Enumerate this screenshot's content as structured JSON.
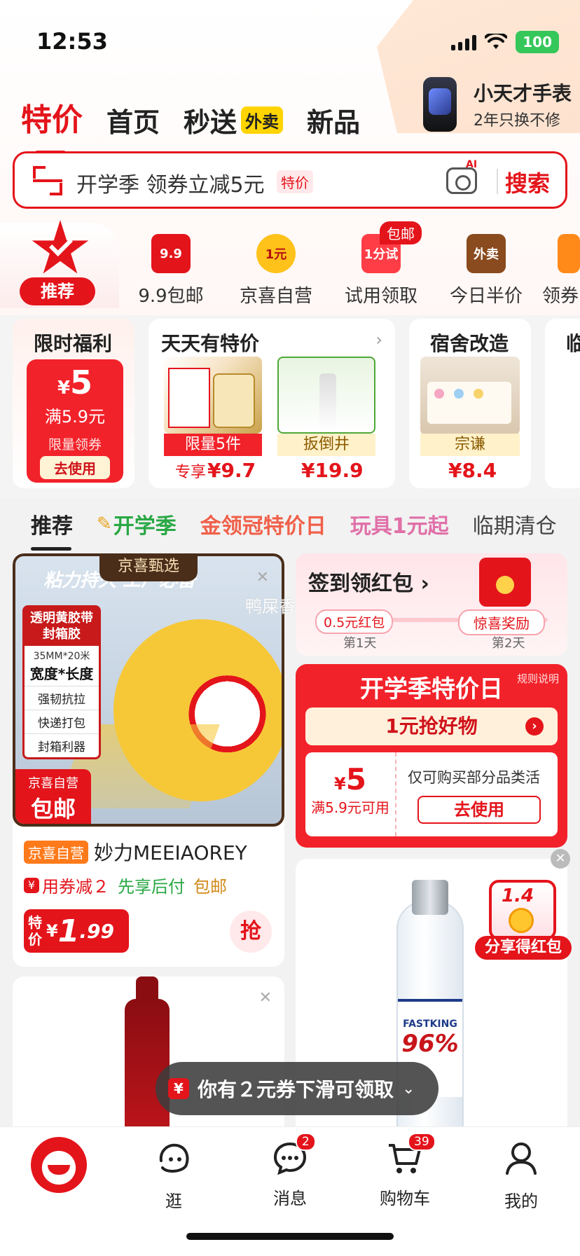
{
  "status": {
    "time": "12:53",
    "battery": "100"
  },
  "header_promo": {
    "title": "小天才手表",
    "subtitle": "2年只换不修"
  },
  "top_tabs": [
    {
      "label": "特价",
      "active": true
    },
    {
      "label": "首页"
    },
    {
      "label": "秒送",
      "badge": "外卖"
    },
    {
      "label": "新品"
    }
  ],
  "search": {
    "placeholder": "开学季 领券立减5元",
    "tag": "特价",
    "ai_label": "AI",
    "button": "搜索"
  },
  "categories": [
    {
      "label": "推荐",
      "icon": "star-check-icon"
    },
    {
      "label": "9.9包邮",
      "icon": "bag-99-icon",
      "icon_text": "9.9"
    },
    {
      "label": "京喜自营",
      "icon": "badge-1yuan-icon",
      "icon_text": "1元"
    },
    {
      "label": "试用领取",
      "icon": "trial-bag-icon",
      "icon_text": "1分试",
      "badge": "包邮"
    },
    {
      "label": "今日半价",
      "icon": "takeout-box-icon",
      "icon_text": "外卖"
    },
    {
      "label": "领券",
      "icon": "coupon-icon"
    }
  ],
  "deal_cards": {
    "limited": {
      "title": "限时福利",
      "currency": "¥",
      "amount": "5",
      "condition": "满5.9元",
      "limit": "限量领券",
      "use": "去使用"
    },
    "daily": {
      "title": "天天有特价",
      "items": [
        {
          "tag": "限量5件",
          "price_prefix": "专享",
          "price": "¥9.7"
        },
        {
          "tag": "扳倒井",
          "price": "¥19.9"
        }
      ]
    },
    "dorm": {
      "title": "宿舍改造",
      "item": {
        "tag": "宗谦",
        "price": "¥8.4"
      }
    },
    "partial": {
      "title": "临"
    }
  },
  "feed_tabs": [
    {
      "label": "推荐",
      "color": "#222222",
      "active": true
    },
    {
      "label": "开学季",
      "color": "#2aa845",
      "icon": "pencil-icon"
    },
    {
      "label": "金领冠特价日",
      "color": "#f0604a"
    },
    {
      "label": "玩具1元起",
      "color": "#e070a8"
    },
    {
      "label": "临期清仓",
      "color": "#444444"
    }
  ],
  "product_1": {
    "top_badge": "京喜甄选",
    "banner": "粘力持久 工厂必备",
    "side_label": {
      "head": "透明黄胶带 封箱胶",
      "size": "35MM*20米",
      "dims": "宽度*长度",
      "features": [
        "强韧抗拉",
        "快递打包",
        "封箱利器"
      ]
    },
    "corner_badge": {
      "line1": "京喜自营",
      "line2": "包邮"
    },
    "store_tag": "京喜自营",
    "name": "妙力MEEIAOREY",
    "tags": {
      "coupon": "用券减２",
      "pay_later": "先享后付",
      "shipping": "包邮"
    },
    "price": {
      "label": "特价",
      "currency": "¥",
      "integer": "1",
      "decimal": ".99"
    },
    "grab": "抢"
  },
  "signin": {
    "title": "签到领红包",
    "step1": "0.5元红包",
    "step2": "惊喜奖励",
    "day1": "第1天",
    "day2": "第2天"
  },
  "watermark": "鸭屎香",
  "school_sale": {
    "title": "开学季特价日",
    "rules": "规则说明",
    "deal": "1元抢好物",
    "coupon": {
      "currency": "¥",
      "amount": "5",
      "condition": "满5.9元可用",
      "desc": "仅可购买部分品类活",
      "button": "去使用"
    }
  },
  "bottle_product": {
    "brand": "FASTKING",
    "abv": "96%"
  },
  "share": {
    "label": "分享得红包",
    "amount": "1.4"
  },
  "toast": {
    "icon_text": "¥",
    "text": "你有２元券下滑可领取"
  },
  "bottom_nav": [
    {
      "label": "",
      "icon": "mascot-icon"
    },
    {
      "label": "逛",
      "icon": "face-icon"
    },
    {
      "label": "消息",
      "icon": "message-icon",
      "badge": "2"
    },
    {
      "label": "购物车",
      "icon": "cart-icon",
      "badge": "39"
    },
    {
      "label": "我的",
      "icon": "profile-icon"
    }
  ]
}
